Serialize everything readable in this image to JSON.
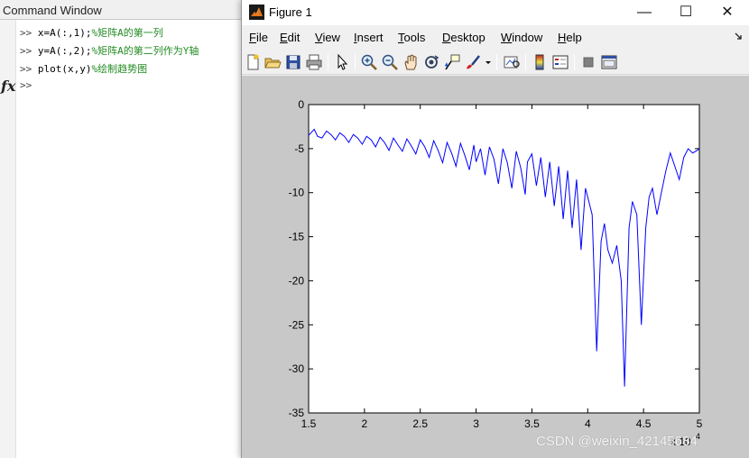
{
  "command_window": {
    "title": "Command Window",
    "prompt": ">>",
    "lines": [
      {
        "code": "x=A(:,1);",
        "comment": "%矩阵A的第一列"
      },
      {
        "code": "y=A(:,2);",
        "comment": "%矩阵A的第二列作为Y轴"
      },
      {
        "code": "plot(x,y)",
        "comment": "%绘制趋势图"
      }
    ],
    "fx_label": "fx"
  },
  "figure": {
    "title": "Figure 1",
    "window_buttons": {
      "minimize": "—",
      "maximize": "☐",
      "close": "✕"
    },
    "menu": [
      {
        "label": "File",
        "accel": "F",
        "rest": "ile"
      },
      {
        "label": "Edit",
        "accel": "E",
        "rest": "dit"
      },
      {
        "label": "View",
        "accel": "V",
        "rest": "iew"
      },
      {
        "label": "Insert",
        "accel": "I",
        "rest": "nsert"
      },
      {
        "label": "Tools",
        "accel": "T",
        "rest": "ools"
      },
      {
        "label": "Desktop",
        "accel": "D",
        "rest": "esktop"
      },
      {
        "label": "Window",
        "accel": "W",
        "rest": "indow"
      },
      {
        "label": "Help",
        "accel": "H",
        "rest": "elp"
      }
    ],
    "menu_overflow_icon": "arrow-icon",
    "toolbar_icons": [
      "new-figure-icon",
      "open-file-icon",
      "save-icon",
      "print-icon",
      "edit-plot-arrow-icon",
      "zoom-in-icon",
      "zoom-out-icon",
      "pan-hand-icon",
      "rotate-3d-icon",
      "data-cursor-icon",
      "brush-icon",
      "link-plot-icon",
      "insert-colorbar-icon",
      "insert-legend-icon",
      "hide-plot-tools-icon",
      "show-plot-tools-icon"
    ]
  },
  "chart_data": {
    "type": "line",
    "title": "",
    "xlabel": "",
    "ylabel": "",
    "xlim": [
      1.5,
      5
    ],
    "ylim": [
      -35,
      0
    ],
    "x_ticks": [
      "1.5",
      "2",
      "2.5",
      "3",
      "3.5",
      "4",
      "4.5",
      "5"
    ],
    "y_ticks": [
      "0",
      "-5",
      "-10",
      "-15",
      "-20",
      "-25",
      "-30",
      "-35"
    ],
    "x_exponent_label": "x 10",
    "x_exponent_power": "4",
    "grid": false,
    "line_color": "#0000ff",
    "series": [
      {
        "x": [
          1.5,
          1.55,
          1.58,
          1.62,
          1.66,
          1.7,
          1.74,
          1.78,
          1.82,
          1.86,
          1.9,
          1.94,
          1.98,
          2.02,
          2.06,
          2.1,
          2.14,
          2.18,
          2.22,
          2.26,
          2.3,
          2.34,
          2.38,
          2.42,
          2.46,
          2.5,
          2.54,
          2.58,
          2.62,
          2.66,
          2.7,
          2.74,
          2.78,
          2.82,
          2.86,
          2.9,
          2.94,
          2.98,
          3.0,
          3.04,
          3.08,
          3.12,
          3.16,
          3.2,
          3.24,
          3.28,
          3.32,
          3.36,
          3.4,
          3.44,
          3.46,
          3.5,
          3.54,
          3.58,
          3.62,
          3.66,
          3.7,
          3.74,
          3.78,
          3.82,
          3.86,
          3.9,
          3.94,
          3.98,
          4.0,
          4.04,
          4.08,
          4.12,
          4.15,
          4.18,
          4.22,
          4.26,
          4.3,
          4.33,
          4.37,
          4.4,
          4.44,
          4.48,
          4.52,
          4.55,
          4.58,
          4.62,
          4.66,
          4.7,
          4.74,
          4.78,
          4.82,
          4.86,
          4.9,
          4.94,
          4.98,
          5.0
        ],
        "y": [
          -3.5,
          -2.8,
          -3.6,
          -3.8,
          -3.0,
          -3.4,
          -4.0,
          -3.2,
          -3.6,
          -4.3,
          -3.4,
          -3.8,
          -4.5,
          -3.6,
          -4.0,
          -4.8,
          -3.7,
          -4.3,
          -5.2,
          -3.8,
          -4.6,
          -5.3,
          -3.9,
          -4.7,
          -5.6,
          -4.0,
          -4.8,
          -6.0,
          -4.1,
          -5.2,
          -6.6,
          -4.3,
          -5.5,
          -7.0,
          -4.4,
          -5.8,
          -7.4,
          -4.6,
          -6.5,
          -5.0,
          -8.0,
          -4.8,
          -6.2,
          -9.0,
          -5.0,
          -6.6,
          -9.5,
          -5.3,
          -7.2,
          -10.2,
          -6.5,
          -5.6,
          -9.2,
          -6.0,
          -10.5,
          -6.5,
          -11.5,
          -7.0,
          -13.0,
          -7.5,
          -14.0,
          -8.5,
          -16.5,
          -9.5,
          -10.5,
          -12.5,
          -28.0,
          -15.5,
          -13.5,
          -16.5,
          -18.0,
          -16.0,
          -20.0,
          -32.0,
          -14.0,
          -11.0,
          -12.5,
          -25.0,
          -14.0,
          -10.5,
          -9.5,
          -12.5,
          -10.0,
          -7.5,
          -5.5,
          -7.0,
          -8.5,
          -6.0,
          -5.0,
          -5.5,
          -5.2,
          -5.0
        ]
      }
    ]
  },
  "watermark": "CSDN @weixin_42145684"
}
